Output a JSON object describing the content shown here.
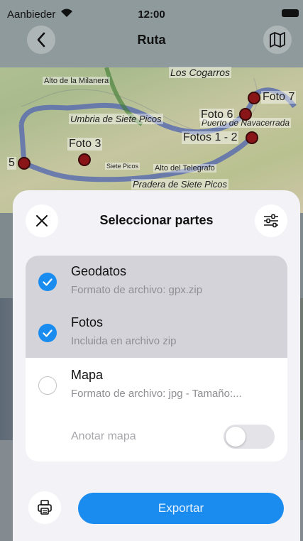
{
  "status_bar": {
    "carrier": "Aanbieder",
    "time": "12:00"
  },
  "nav": {
    "title": "Ruta",
    "back_icon": "chevron-left-icon",
    "map_icon": "map-icon"
  },
  "map": {
    "labels": [
      "Los Cogarros",
      "Alto de la Milanera",
      "Umbria de Siete Picos",
      "Puerto de Navacerrada",
      "Siete Picos",
      "Alto del Telegrafo",
      "Pradera de Siete Picos"
    ],
    "pins": [
      "Foto 7",
      "Foto 6",
      "Fotos 1 - 2",
      "Foto 3",
      "5"
    ]
  },
  "sheet": {
    "title": "Seleccionar partes",
    "close_icon": "close-icon",
    "filter_icon": "sliders-icon",
    "options": [
      {
        "title": "Geodatos",
        "subtitle": "Formato de archivo: gpx.zip",
        "checked": true
      },
      {
        "title": "Fotos",
        "subtitle": "Incluida en archivo zip",
        "checked": true
      },
      {
        "title": "Mapa",
        "subtitle": "Formato de archivo: jpg - Tamaño:...",
        "checked": false
      }
    ],
    "annotate_label": "Anotar mapa",
    "annotate_on": false,
    "print_icon": "printer-icon",
    "export_label": "Exportar"
  },
  "colors": {
    "accent": "#1a8cf0",
    "selected_row": "#d3d3d9",
    "pin": "#8a1518"
  }
}
